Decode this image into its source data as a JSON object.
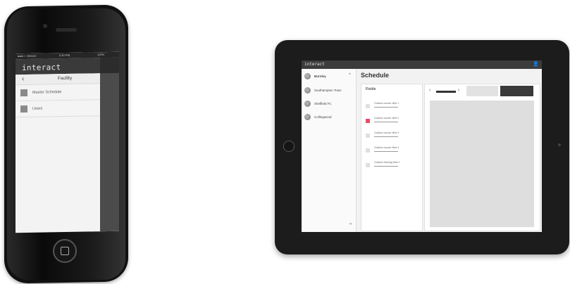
{
  "phone": {
    "status": {
      "carrier": "●●●○○ Verizon",
      "time": "9:40 PM",
      "battery": "100%"
    },
    "brand": "interact",
    "nav": {
      "back_icon": "chevron-left-icon",
      "back": "‹",
      "title": "Facility"
    },
    "items": [
      {
        "label": "Master Schedule",
        "icon": "square-icon"
      },
      {
        "label": "Users",
        "icon": "square-icon"
      }
    ]
  },
  "tablet": {
    "brand": "interact",
    "user_icon": "user-icon",
    "user_glyph": "👤",
    "sidebar": {
      "items": [
        {
          "label": "Burnley",
          "expanded": true,
          "chevron": "^"
        },
        {
          "label": "Southampton Town"
        },
        {
          "label": "Sheffield FC"
        },
        {
          "label": "Collingwood"
        }
      ],
      "collapse": "«"
    },
    "schedule_title": "Schedule",
    "fields": {
      "title": "Fields",
      "items": [
        {
          "label": "Outdoor soccer field 1",
          "color": "#e0e0e0"
        },
        {
          "label": "Outdoor soccer field 2",
          "color": "#e84a6a"
        },
        {
          "label": "Outdoor soccer field 3",
          "color": "#e0e0e0"
        },
        {
          "label": "Outdoor soccer field 4",
          "color": "#e0e0e0"
        },
        {
          "label": "Outdoor training field 1",
          "color": "#e0e0e0"
        }
      ]
    },
    "calendar": {
      "prev": "‹",
      "next": "›"
    }
  }
}
